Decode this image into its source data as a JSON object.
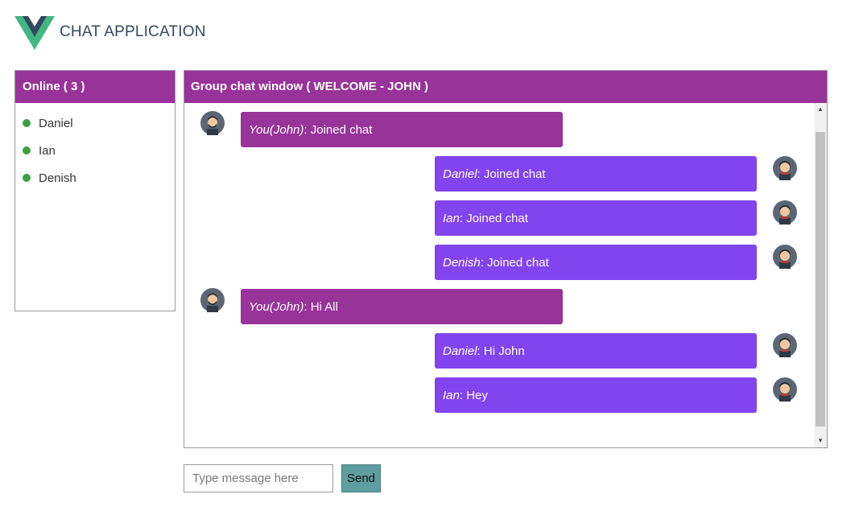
{
  "app": {
    "title": "CHAT APPLICATION",
    "logo": "vue-logo"
  },
  "online": {
    "title": "Online ( 3 )",
    "users": [
      {
        "name": "Daniel",
        "status_color": "#3aa043"
      },
      {
        "name": "Ian",
        "status_color": "#3aa043"
      },
      {
        "name": "Denish",
        "status_color": "#3aa043"
      }
    ]
  },
  "chat": {
    "title": "Group chat window ( WELCOME - JOHN )",
    "messages": [
      {
        "sender": "You(John)",
        "text": ": Joined chat",
        "self": true
      },
      {
        "sender": "Daniel",
        "text": ": Joined chat",
        "self": false
      },
      {
        "sender": "Ian",
        "text": ": Joined chat",
        "self": false
      },
      {
        "sender": "Denish",
        "text": ": Joined chat",
        "self": false
      },
      {
        "sender": "You(John)",
        "text": ": Hi All",
        "self": true
      },
      {
        "sender": "Daniel",
        "text": ": Hi John",
        "self": false
      },
      {
        "sender": "Ian",
        "text": ": Hey",
        "self": false
      }
    ]
  },
  "composer": {
    "placeholder": "Type message here",
    "value": "",
    "send_label": "Send"
  },
  "colors": {
    "header_bg": "#983399",
    "self_bubble": "#983399",
    "other_bubble": "#8244ee",
    "send_button": "#5f9ea0",
    "online_dot": "#3aa043"
  }
}
